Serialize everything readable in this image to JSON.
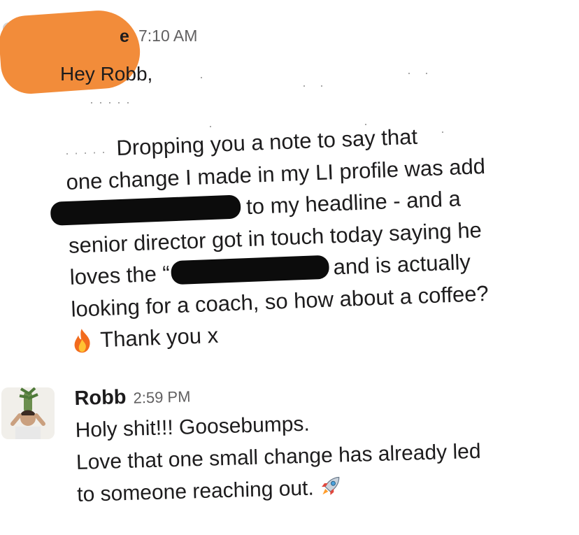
{
  "message_1": {
    "sender_fragment": "e",
    "time": "7:10 AM",
    "greeting": "Hey Robb,",
    "lines": [
      "Dropping you a note to say that",
      "one change I made in my LI profile was add",
      "to my headline - and a",
      "senior director got in touch today saying he",
      "loves the “",
      "and is actually",
      "looking for a coach, so how about a coffee?",
      "Thank you x"
    ],
    "emoji": "fire-icon"
  },
  "message_2": {
    "sender": "Robb",
    "time": "2:59 PM",
    "lines": [
      "Holy shit!!! Goosebumps.",
      "Love that one small change has already led",
      "to someone reaching out."
    ],
    "emoji": "rocket-icon"
  },
  "colors": {
    "redaction_orange": "#f28c3a",
    "redaction_black": "#0c0c0c",
    "timestamp_gray": "#616061"
  }
}
